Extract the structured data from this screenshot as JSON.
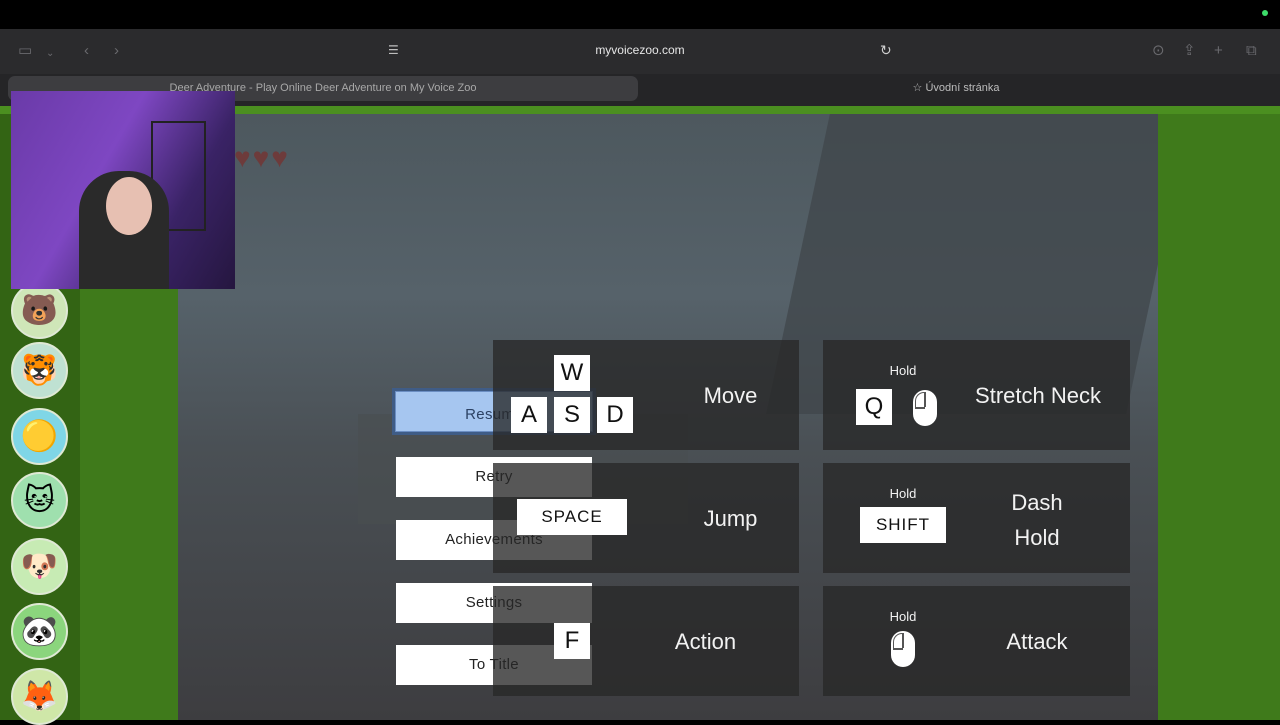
{
  "browser": {
    "url": "myvoicezoo.com",
    "tabs": [
      {
        "label": "Deer Adventure - Play Online Deer Adventure on My Voice Zoo"
      },
      {
        "label": "Úvodní stránka"
      }
    ]
  },
  "sidebar": {
    "avatars": [
      {
        "name": "bear-rabbit-avatar",
        "glyph": "🐻"
      },
      {
        "name": "tiger-avatar",
        "glyph": "🐯"
      },
      {
        "name": "pacman-avatar",
        "glyph": "🟡"
      },
      {
        "name": "cat-dog-avatar",
        "glyph": "🐱"
      },
      {
        "name": "corgi-avatar",
        "glyph": "🐶"
      },
      {
        "name": "panda-avatar",
        "glyph": "🐼"
      },
      {
        "name": "fox-avatar",
        "glyph": "🦊"
      }
    ]
  },
  "pause_menu": {
    "buttons": [
      {
        "label": "Resume",
        "active": true
      },
      {
        "label": "Retry",
        "active": false
      },
      {
        "label": "Achievements",
        "active": false
      },
      {
        "label": "Settings",
        "active": false
      },
      {
        "label": "To Title",
        "active": false
      }
    ]
  },
  "controls": {
    "move": {
      "keys": [
        "W",
        "A",
        "S",
        "D"
      ],
      "label": "Move"
    },
    "stretch_neck": {
      "hold": "Hold",
      "key": "Q",
      "label": "Stretch Neck"
    },
    "jump": {
      "key": "SPACE",
      "label": "Jump"
    },
    "dash": {
      "hold": "Hold",
      "key": "SHIFT",
      "label_line1": "Dash",
      "label_line2": "Hold"
    },
    "action": {
      "key": "F",
      "label": "Action"
    },
    "attack": {
      "hold": "Hold",
      "label": "Attack"
    }
  },
  "colors": {
    "page_green": "#3f7a1b",
    "resume_highlight": "#a6c6f0",
    "panel_bg": "rgba(40,40,40,0.78)"
  }
}
